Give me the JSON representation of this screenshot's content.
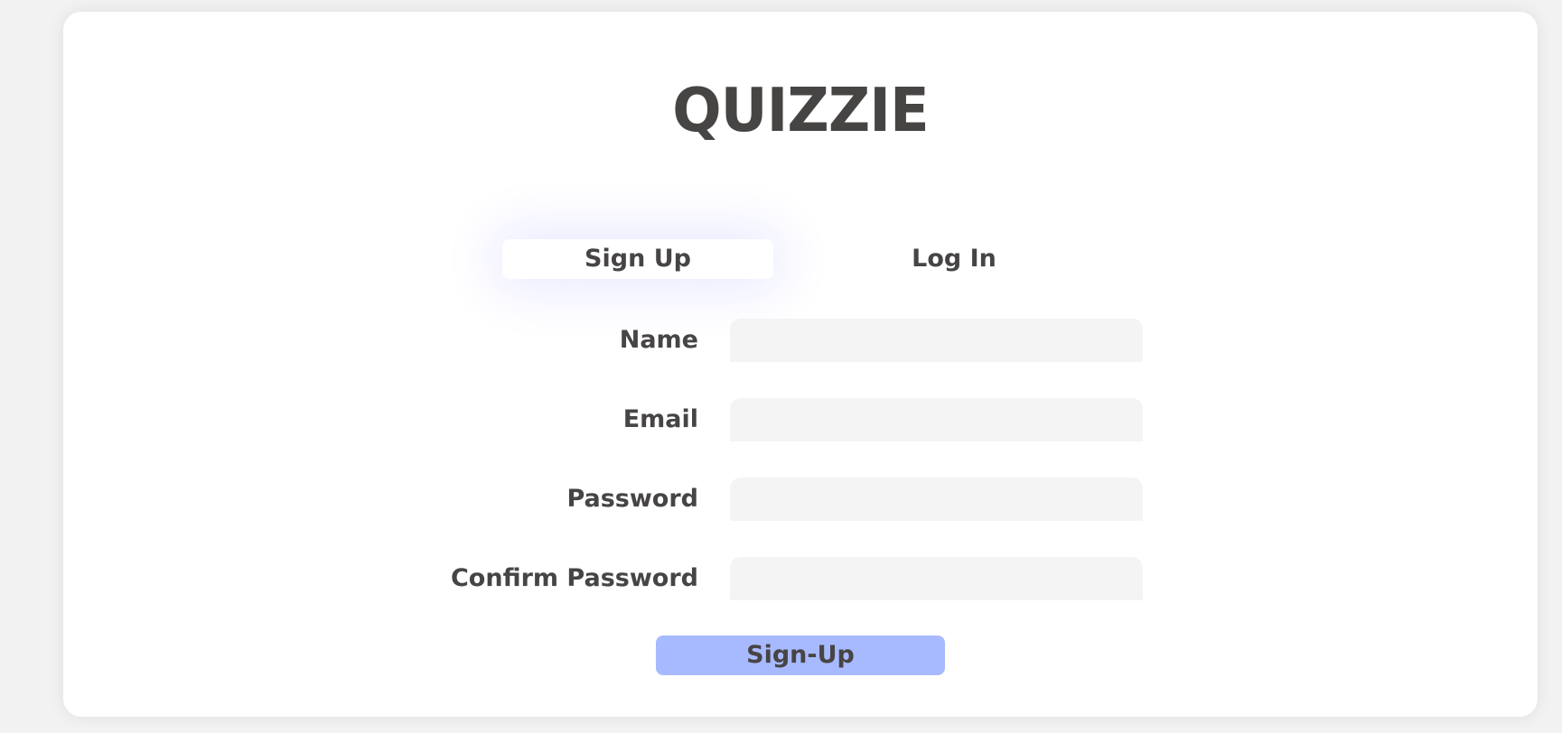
{
  "app": {
    "brand": "QUIZZIE"
  },
  "tabs": [
    {
      "label": "Sign Up",
      "active": true
    },
    {
      "label": "Log In",
      "active": false
    }
  ],
  "form": {
    "fields": [
      {
        "label": "Name",
        "value": "",
        "placeholder": ""
      },
      {
        "label": "Email",
        "value": "",
        "placeholder": ""
      },
      {
        "label": "Password",
        "value": "",
        "placeholder": ""
      },
      {
        "label": "Confirm Password",
        "value": "",
        "placeholder": ""
      }
    ],
    "submit_label": "Sign-Up"
  },
  "colors": {
    "text": "#474444",
    "page_bg": "#f2f2f2",
    "card_bg": "#ffffff",
    "input_bg": "#f4f4f4",
    "button_bg": "#a7baff",
    "tab_glow": "#0019ff"
  }
}
